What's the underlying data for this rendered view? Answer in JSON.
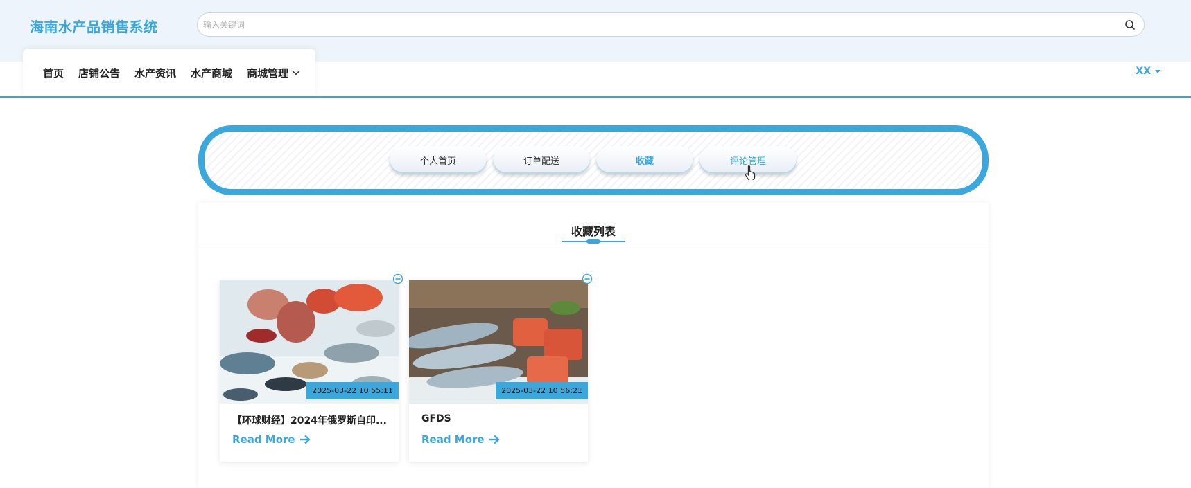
{
  "header": {
    "brand": "海南水产品销售系统",
    "search_placeholder": "输入关键词"
  },
  "nav": {
    "items": [
      {
        "label": "首页"
      },
      {
        "label": "店铺公告"
      },
      {
        "label": "水产资讯"
      },
      {
        "label": "水产商城"
      },
      {
        "label": "商城管理"
      }
    ],
    "user": "XX"
  },
  "tabs": [
    {
      "label": "个人首页"
    },
    {
      "label": "订单配送"
    },
    {
      "label": "收藏"
    },
    {
      "label": "评论管理"
    }
  ],
  "panel": {
    "title": "收藏列表"
  },
  "favorites": [
    {
      "date": "2025-03-22 10:55:11",
      "title": "【环球财经】2024年俄罗斯自印...",
      "more": "Read More"
    },
    {
      "date": "2025-03-22 10:56:21",
      "title": "GFDS",
      "more": "Read More"
    }
  ],
  "colors": {
    "accent": "#3aa8dc",
    "header_bg": "#eef4fb"
  }
}
